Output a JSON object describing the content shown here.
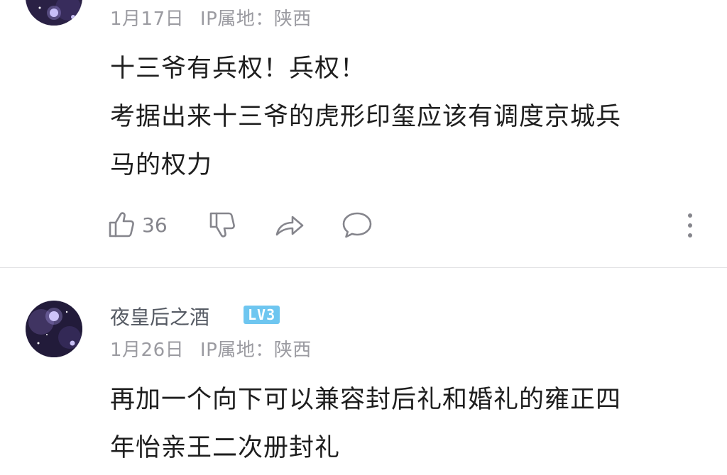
{
  "comments": [
    {
      "date": "1月17日",
      "ip_location": "IP属地：陕西",
      "content_lines": [
        "十三爷有兵权！兵权！",
        "考据出来十三爷的虎形印玺应该有调度京城兵",
        "马的权力"
      ],
      "like_count": "36",
      "icons": {
        "like": "thumbs-up-icon",
        "dislike": "thumbs-down-icon",
        "share": "share-icon",
        "reply": "comment-icon",
        "more": "more-vertical-icon"
      }
    },
    {
      "username": "夜皇后之酒",
      "level": "LV3",
      "date": "1月26日",
      "ip_location": "IP属地：陕西",
      "content_lines": [
        "再加一个向下可以兼容封后礼和婚礼的雍正四",
        "年怡亲王二次册封礼"
      ]
    }
  ],
  "colors": {
    "meta_text": "#9b9ba1",
    "content_text": "#1e1e1e",
    "username_text": "#555a63",
    "level_badge": "#6ec6f0",
    "icon_stroke": "#85858c",
    "divider": "#e2e2e4"
  }
}
